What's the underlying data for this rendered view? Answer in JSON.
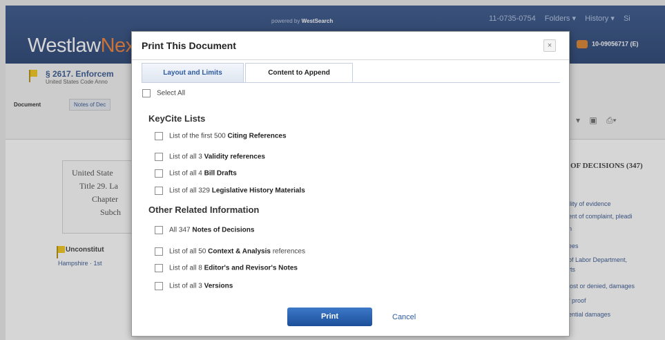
{
  "app": {
    "powered_prefix": "powered by",
    "powered_brand": "WestSearch",
    "top_links": [
      "11-0735-0754",
      "Folders ▾",
      "History ▾",
      "Si"
    ],
    "logo_main": "Westlaw",
    "logo_accent": "Nex",
    "client_id": "10-09056717 (E)"
  },
  "document": {
    "title": "§ 2617. Enforcem",
    "subtitle": "United States Code Anno",
    "tab_active": "Document",
    "tab_other": "Notes of Dec",
    "left_panel_lines": [
      "United State",
      "Title 29. La",
      "Chapter",
      "Subch"
    ],
    "unconstit": "Unconstitut",
    "hampshire": "Hampshire · 1st"
  },
  "right_panel": {
    "title": "OF DECISIONS (347)",
    "links": [
      "ility of evidence",
      "ent of complaint, pleadi",
      "n",
      "ees",
      "of Labor Department,",
      "rts",
      "lost or denied, damages",
      "f proof",
      "ential damages"
    ]
  },
  "dialog": {
    "title": "Print This Document",
    "close_glyph": "×",
    "tabs": {
      "layout": "Layout and Limits",
      "append": "Content to Append"
    },
    "select_all": "Select All",
    "sections": {
      "keycite": "KeyCite Lists",
      "other": "Other Related Information"
    },
    "keycite_items": [
      {
        "pre": "List of the first 500 ",
        "bold": "Citing References",
        "post": ""
      },
      {
        "pre": "List of all 3 ",
        "bold": "Validity references",
        "post": ""
      },
      {
        "pre": "List of all 4 ",
        "bold": "Bill Drafts",
        "post": ""
      },
      {
        "pre": "List of all 329 ",
        "bold": "Legislative History Materials",
        "post": ""
      }
    ],
    "other_items": [
      {
        "pre": "All 347 ",
        "bold": "Notes of Decisions",
        "post": ""
      },
      {
        "pre": "List of all 50 ",
        "bold": "Context & Analysis",
        "post": " references"
      },
      {
        "pre": "List of all 8 ",
        "bold": "Editor's and Revisor's Notes",
        "post": ""
      },
      {
        "pre": "List of all 3 ",
        "bold": "Versions",
        "post": ""
      }
    ],
    "print_label": "Print",
    "cancel_label": "Cancel"
  }
}
